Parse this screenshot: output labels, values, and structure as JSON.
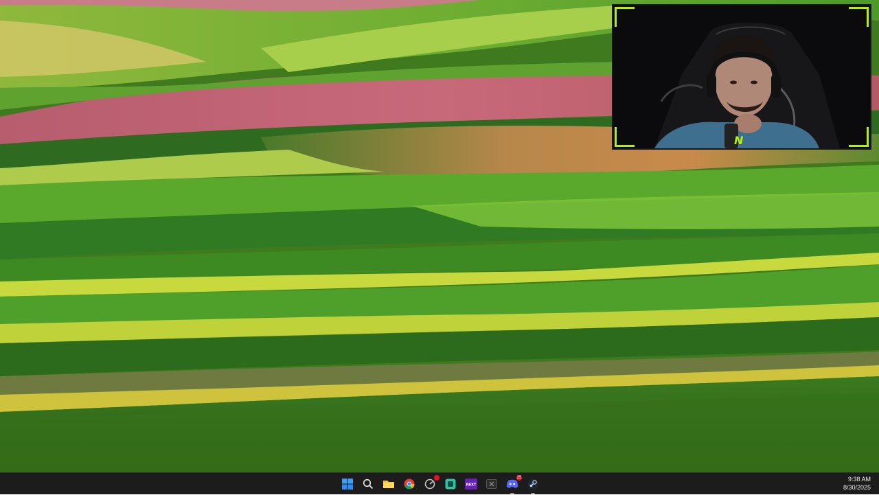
{
  "wallpaper": {
    "description_icon": "rolling-striped-fields-wallpaper",
    "colors": {
      "sky_green": "#4e8a24",
      "pink_field": "#c4607a",
      "orange_field": "#c98a4a",
      "lime_band": "#c4d23a",
      "dark_green": "#2a5e1c",
      "mid_green": "#4f9a2a",
      "bright_green": "#7cc33a"
    }
  },
  "webcam_overlay": {
    "brand_mark": "N",
    "accent_color": "#b7f000"
  },
  "taskbar": {
    "icons": [
      {
        "id": "start",
        "icon": "windows-start-icon",
        "color": "#2f8cf4"
      },
      {
        "id": "search",
        "icon": "search-icon",
        "color": "#e8e8e8"
      },
      {
        "id": "explorer",
        "icon": "file-explorer-icon",
        "color": "#f6c343"
      },
      {
        "id": "chrome",
        "icon": "chrome-icon",
        "color": "#4285f4"
      },
      {
        "id": "app5",
        "icon": "resource-monitor-icon",
        "color": "#c9c9c9",
        "badge": ""
      },
      {
        "id": "app6",
        "icon": "green-app-icon",
        "color": "#2ec4a6"
      },
      {
        "id": "next",
        "icon": "next-app-icon",
        "label": "NEXT",
        "color": "#6a1fb5"
      },
      {
        "id": "app8",
        "icon": "x-app-icon",
        "color": "#444444"
      },
      {
        "id": "discord",
        "icon": "discord-icon",
        "color": "#5865f2",
        "badge": "25"
      },
      {
        "id": "steam",
        "icon": "steam-icon",
        "color": "#1b2838"
      }
    ],
    "clock": {
      "time": "9:38 AM",
      "date": "8/30/2025"
    }
  }
}
